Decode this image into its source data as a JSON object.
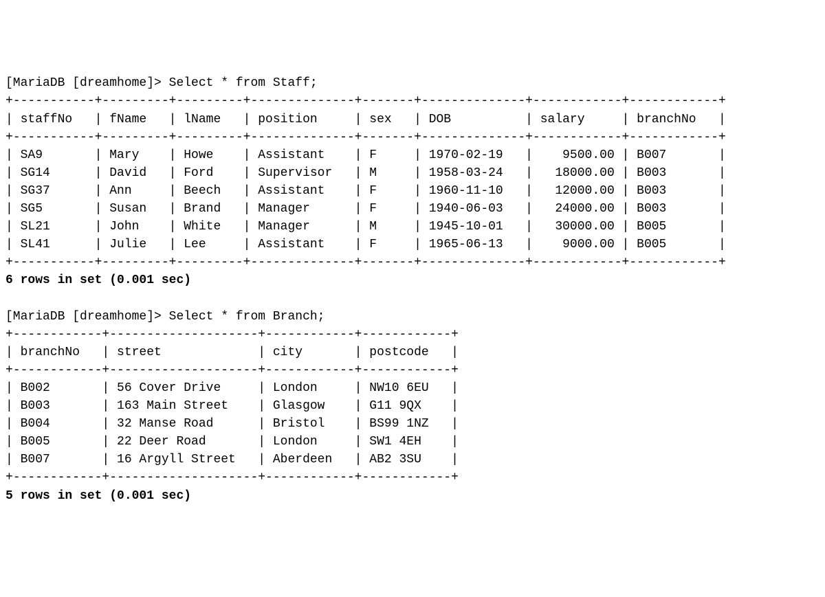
{
  "prompt1": "[MariaDB [dreamhome]> Select * from Staff;",
  "staff": {
    "cols": [
      "staffNo",
      "fName",
      "lName",
      "position",
      "sex",
      "DOB",
      "salary",
      "branchNo"
    ],
    "widths": [
      9,
      7,
      7,
      12,
      5,
      12,
      10,
      10
    ],
    "right": [
      false,
      false,
      false,
      false,
      false,
      false,
      true,
      false
    ],
    "rows": [
      [
        "SA9",
        "Mary",
        "Howe",
        "Assistant",
        "F",
        "1970-02-19",
        "9500.00",
        "B007"
      ],
      [
        "SG14",
        "David",
        "Ford",
        "Supervisor",
        "M",
        "1958-03-24",
        "18000.00",
        "B003"
      ],
      [
        "SG37",
        "Ann",
        "Beech",
        "Assistant",
        "F",
        "1960-11-10",
        "12000.00",
        "B003"
      ],
      [
        "SG5",
        "Susan",
        "Brand",
        "Manager",
        "F",
        "1940-06-03",
        "24000.00",
        "B003"
      ],
      [
        "SL21",
        "John",
        "White",
        "Manager",
        "M",
        "1945-10-01",
        "30000.00",
        "B005"
      ],
      [
        "SL41",
        "Julie",
        "Lee",
        "Assistant",
        "F",
        "1965-06-13",
        "9000.00",
        "B005"
      ]
    ],
    "status": "6 rows in set (0.001 sec)"
  },
  "prompt2": "[MariaDB [dreamhome]> Select * from Branch;",
  "branch": {
    "cols": [
      "branchNo",
      "street",
      "city",
      "postcode"
    ],
    "widths": [
      10,
      18,
      10,
      10
    ],
    "right": [
      false,
      false,
      false,
      false
    ],
    "rows": [
      [
        "B002",
        "56 Cover Drive",
        "London",
        "NW10 6EU"
      ],
      [
        "B003",
        "163 Main Street",
        "Glasgow",
        "G11 9QX"
      ],
      [
        "B004",
        "32 Manse Road",
        "Bristol",
        "BS99 1NZ"
      ],
      [
        "B005",
        "22 Deer Road",
        "London",
        "SW1 4EH"
      ],
      [
        "B007",
        "16 Argyll Street",
        "Aberdeen",
        "AB2 3SU"
      ]
    ],
    "status": "5 rows in set (0.001 sec)"
  }
}
